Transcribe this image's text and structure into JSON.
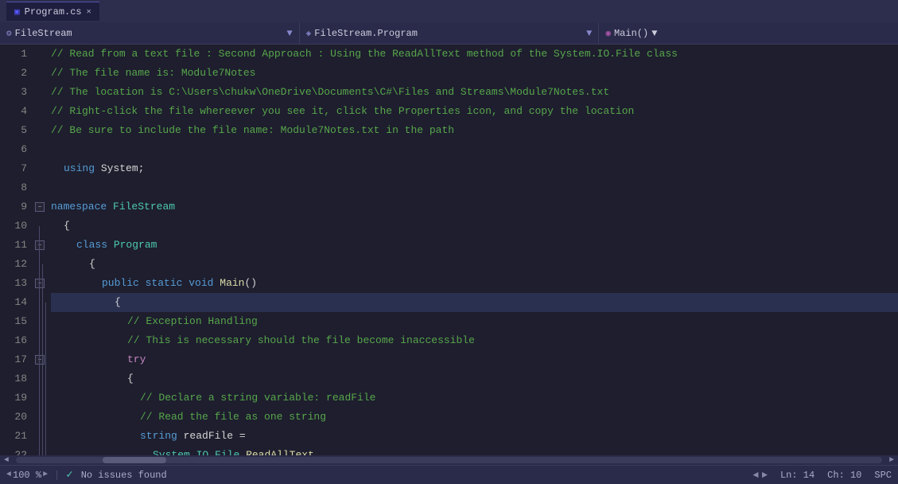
{
  "titleBar": {
    "tabLabel": "Program.cs",
    "tabClose": "✕"
  },
  "navBar": {
    "namespace": "FileStream",
    "namespaceIcon": "⚙",
    "classPath": "FileStream.Program",
    "classIcon": "◈",
    "method": "Main()",
    "methodIcon": "◉"
  },
  "lines": [
    {
      "num": 1,
      "hasFold": false,
      "foldType": null,
      "content": "// Read from a text file : Second Approach : Using the ReadAllText method of the System.IO.File class",
      "type": "comment"
    },
    {
      "num": 2,
      "hasFold": false,
      "foldType": null,
      "content": "// The file name is: Module7Notes",
      "type": "comment"
    },
    {
      "num": 3,
      "hasFold": false,
      "foldType": null,
      "content": "// The location is C:\\Users\\chukw\\OneDrive\\Documents\\C#\\Files and Streams\\Module7Notes.txt",
      "type": "comment"
    },
    {
      "num": 4,
      "hasFold": false,
      "foldType": null,
      "content": "// Right-click the file whereever you see it, click the Properties icon, and copy the location",
      "type": "comment"
    },
    {
      "num": 5,
      "hasFold": false,
      "foldType": null,
      "content": "// Be sure to include the file name: Module7Notes.txt in the path",
      "type": "comment"
    },
    {
      "num": 6,
      "hasFold": false,
      "foldType": null,
      "content": "",
      "type": "empty"
    },
    {
      "num": 7,
      "hasFold": false,
      "foldType": null,
      "content": "    using_System",
      "type": "using"
    },
    {
      "num": 8,
      "hasFold": false,
      "foldType": null,
      "content": "",
      "type": "empty"
    },
    {
      "num": 9,
      "hasFold": true,
      "foldType": "minus",
      "content": "namespace_FileStream",
      "type": "namespace"
    },
    {
      "num": 10,
      "hasFold": false,
      "foldType": null,
      "content": "    {",
      "type": "brace"
    },
    {
      "num": 11,
      "hasFold": true,
      "foldType": "minus",
      "content": "        class_Program",
      "type": "class"
    },
    {
      "num": 12,
      "hasFold": false,
      "foldType": null,
      "content": "        {",
      "type": "brace"
    },
    {
      "num": 13,
      "hasFold": true,
      "foldType": "minus",
      "content": "            public static void Main()",
      "type": "method"
    },
    {
      "num": 14,
      "hasFold": false,
      "foldType": null,
      "content": "            {",
      "type": "brace"
    },
    {
      "num": 15,
      "hasFold": false,
      "foldType": null,
      "content": "                // Exception Handling",
      "type": "comment-indent"
    },
    {
      "num": 16,
      "hasFold": false,
      "foldType": null,
      "content": "                // This is necessary should the file become inaccessible",
      "type": "comment-indent"
    },
    {
      "num": 17,
      "hasFold": true,
      "foldType": "minus",
      "content": "                try",
      "type": "try"
    },
    {
      "num": 18,
      "hasFold": false,
      "foldType": null,
      "content": "                {",
      "type": "brace-indent"
    },
    {
      "num": 19,
      "hasFold": false,
      "foldType": null,
      "content": "                    // Declare a string variable: readFile",
      "type": "comment-indent2"
    },
    {
      "num": 20,
      "hasFold": false,
      "foldType": null,
      "content": "                    // Read the file as one string",
      "type": "comment-indent2"
    },
    {
      "num": 21,
      "hasFold": false,
      "foldType": null,
      "content": "                    string readFile =",
      "type": "string-assign"
    },
    {
      "num": 22,
      "hasFold": false,
      "foldType": null,
      "content": "                        System.IO.File.ReadAllText...",
      "type": "method-call"
    }
  ],
  "statusBar": {
    "zoom": "100 %",
    "zoomArrowLeft": "◄",
    "zoomArrowRight": "►",
    "statusIcon": "✓",
    "statusText": "No issues found",
    "navArrowLeft": "◄",
    "navArrowRight": "►",
    "lineInfo": "Ln: 14",
    "colInfo": "Ch: 10",
    "encoding": "SPC"
  }
}
